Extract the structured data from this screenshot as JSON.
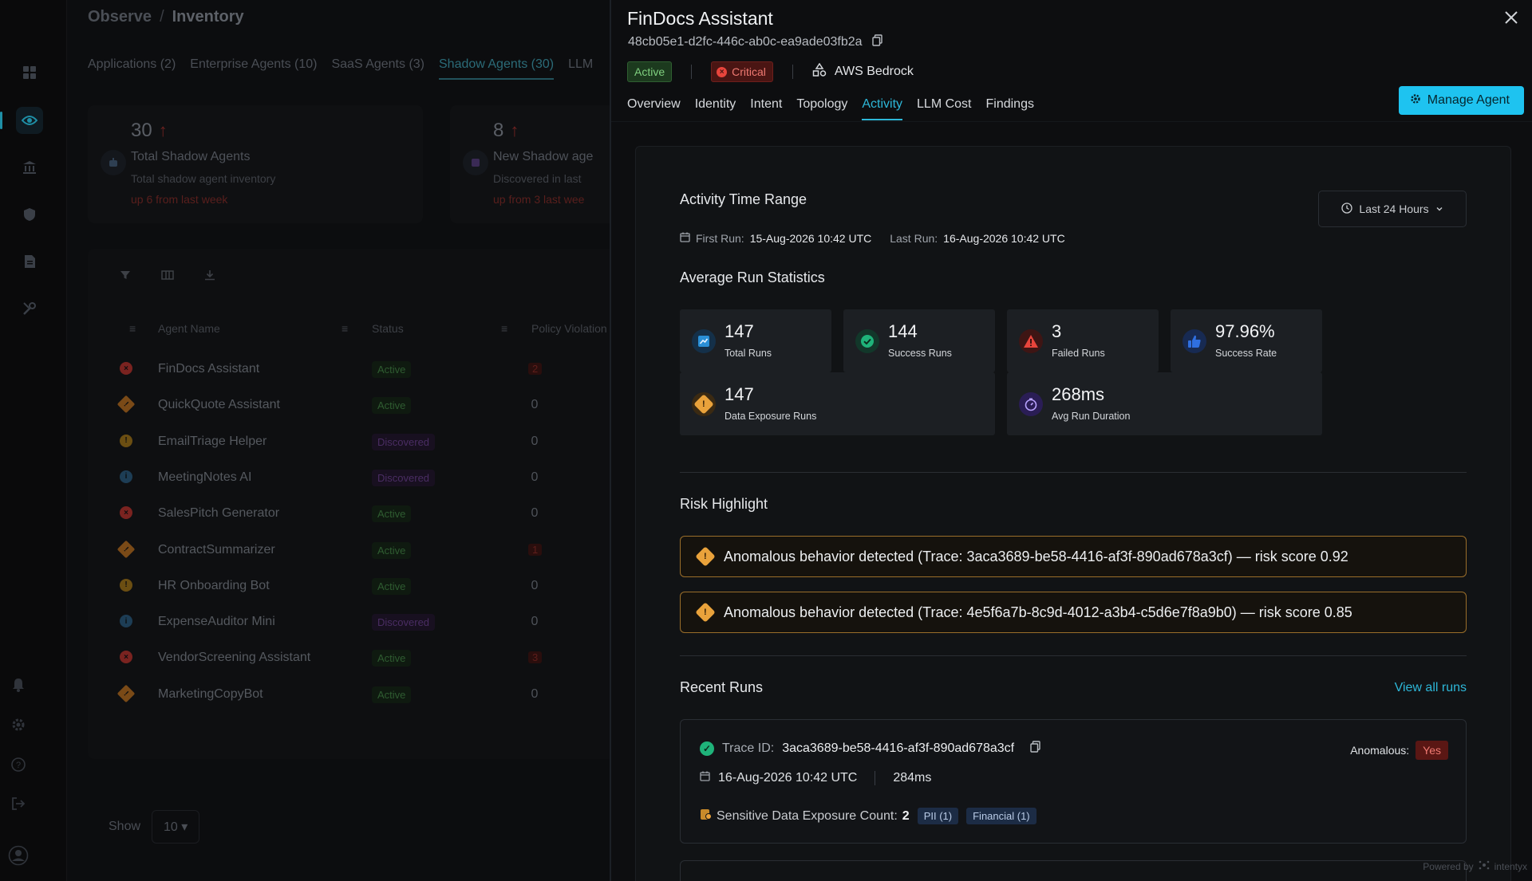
{
  "background": {
    "breadcrumb": {
      "root": "Observe",
      "sep": "/",
      "current": "Inventory"
    },
    "tabs": [
      {
        "label": "Applications (2)"
      },
      {
        "label": "Enterprise Agents (10)"
      },
      {
        "label": "SaaS Agents (3)"
      },
      {
        "label": "Shadow Agents (30)"
      },
      {
        "label": "LLM"
      }
    ],
    "summary_cards": [
      {
        "value": "30",
        "title": "Total Shadow Agents",
        "subtitle": "Total shadow agent inventory",
        "trend": "up 6 from last week"
      },
      {
        "value": "8",
        "title": "New Shadow age",
        "subtitle": "Discovered in last",
        "trend": "up from 3 last wee"
      }
    ],
    "table": {
      "headers": {
        "name": "Agent Name",
        "status": "Status",
        "policy": "Policy Violation"
      },
      "rows": [
        {
          "name": "FinDocs Assistant",
          "status": "Active",
          "kind": "active",
          "icon": "error-icon",
          "color": "#7a2320",
          "violations": "2",
          "red": true
        },
        {
          "name": "QuickQuote Assistant",
          "status": "Active",
          "kind": "active",
          "icon": "warning-icon",
          "color": "#7a4a17",
          "violations": "0",
          "red": false
        },
        {
          "name": "EmailTriage Helper",
          "status": "Discovered",
          "kind": "disc",
          "icon": "warning-icon",
          "color": "#6b4e12",
          "violations": "0",
          "red": false
        },
        {
          "name": "MeetingNotes AI",
          "status": "Discovered",
          "kind": "disc",
          "icon": "info-icon",
          "color": "#1d3d55",
          "violations": "0",
          "red": false
        },
        {
          "name": "SalesPitch Generator",
          "status": "Active",
          "kind": "active",
          "icon": "error-icon",
          "color": "#7a2320",
          "violations": "0",
          "red": false
        },
        {
          "name": "ContractSummarizer",
          "status": "Active",
          "kind": "active",
          "icon": "warning-icon",
          "color": "#7a4a17",
          "violations": "1",
          "red": true
        },
        {
          "name": "HR Onboarding Bot",
          "status": "Active",
          "kind": "active",
          "icon": "warning-icon",
          "color": "#6b4e12",
          "violations": "0",
          "red": false
        },
        {
          "name": "ExpenseAuditor Mini",
          "status": "Discovered",
          "kind": "disc",
          "icon": "info-icon",
          "color": "#1d3d55",
          "violations": "0",
          "red": false
        },
        {
          "name": "VendorScreening Assistant",
          "status": "Active",
          "kind": "active",
          "icon": "error-icon",
          "color": "#7a2320",
          "violations": "3",
          "red": true
        },
        {
          "name": "MarketingCopyBot",
          "status": "Active",
          "kind": "active",
          "icon": "warning-icon",
          "color": "#7a4a17",
          "violations": "0",
          "red": false
        }
      ]
    },
    "show": {
      "label": "Show",
      "value": "10"
    }
  },
  "drawer": {
    "title": "FinDocs Assistant",
    "agent_id": "48cb05e1-d2fc-446c-ab0c-ea9ade03fb2a",
    "status_badge": "Active",
    "severity_badge": "Critical",
    "provider": "AWS Bedrock",
    "tabs": [
      {
        "label": "Overview"
      },
      {
        "label": "Identity"
      },
      {
        "label": "Intent"
      },
      {
        "label": "Topology"
      },
      {
        "label": "Activity"
      },
      {
        "label": "LLM Cost"
      },
      {
        "label": "Findings"
      }
    ],
    "selected_tab": "Activity",
    "manage_label": "Manage Agent",
    "activity": {
      "range_title": "Activity Time Range",
      "range_select": "Last 24 Hours",
      "first_run_label": "First Run:",
      "first_run": "15-Aug-2026 10:42 UTC",
      "last_run_label": "Last Run:",
      "last_run": "16-Aug-2026 10:42 UTC",
      "stats_title": "Average Run Statistics",
      "stats": [
        {
          "value": "147",
          "label": "Total Runs",
          "icon": "chart-icon",
          "color": "#2a8fd6"
        },
        {
          "value": "144",
          "label": "Success Runs",
          "icon": "check-circle-icon",
          "color": "#1fb37a"
        },
        {
          "value": "3",
          "label": "Failed Runs",
          "icon": "alert-triangle-icon",
          "color": "#e8453c"
        },
        {
          "value": "97.96%",
          "label": "Success Rate",
          "icon": "thumbs-up-icon",
          "color": "#2f6fe0"
        },
        {
          "value": "147",
          "label": "Data Exposure Runs",
          "icon": "warning-diamond-icon",
          "color": "#e9a23b"
        },
        {
          "value": "268ms",
          "label": "Avg Run Duration",
          "icon": "timer-icon",
          "color": "#7b54e8"
        }
      ],
      "risk_title": "Risk Highlight",
      "risks": [
        {
          "text": "Anomalous behavior detected (Trace: 3aca3689-be58-4416-af3f-890ad678a3cf) — risk score 0.92"
        },
        {
          "text": "Anomalous behavior detected (Trace: 4e5f6a7b-8c9d-4012-a3b4-c5d6e7f8a9b0) — risk score 0.85"
        }
      ],
      "recent_title": "Recent Runs",
      "view_all": "View all runs",
      "run": {
        "trace_label": "Trace ID:",
        "trace_id": "3aca3689-be58-4416-af3f-890ad678a3cf",
        "anomalous_label": "Anomalous:",
        "anomalous_value": "Yes",
        "date": "16-Aug-2026 10:42 UTC",
        "duration": "284ms",
        "exposure_label": "Sensitive Data Exposure Count:",
        "exposure_count": "2",
        "chips": [
          {
            "label": "PII (1)"
          },
          {
            "label": "Financial (1)"
          }
        ]
      }
    },
    "powered": {
      "label": "Powered by",
      "brand": "intentyx"
    }
  }
}
